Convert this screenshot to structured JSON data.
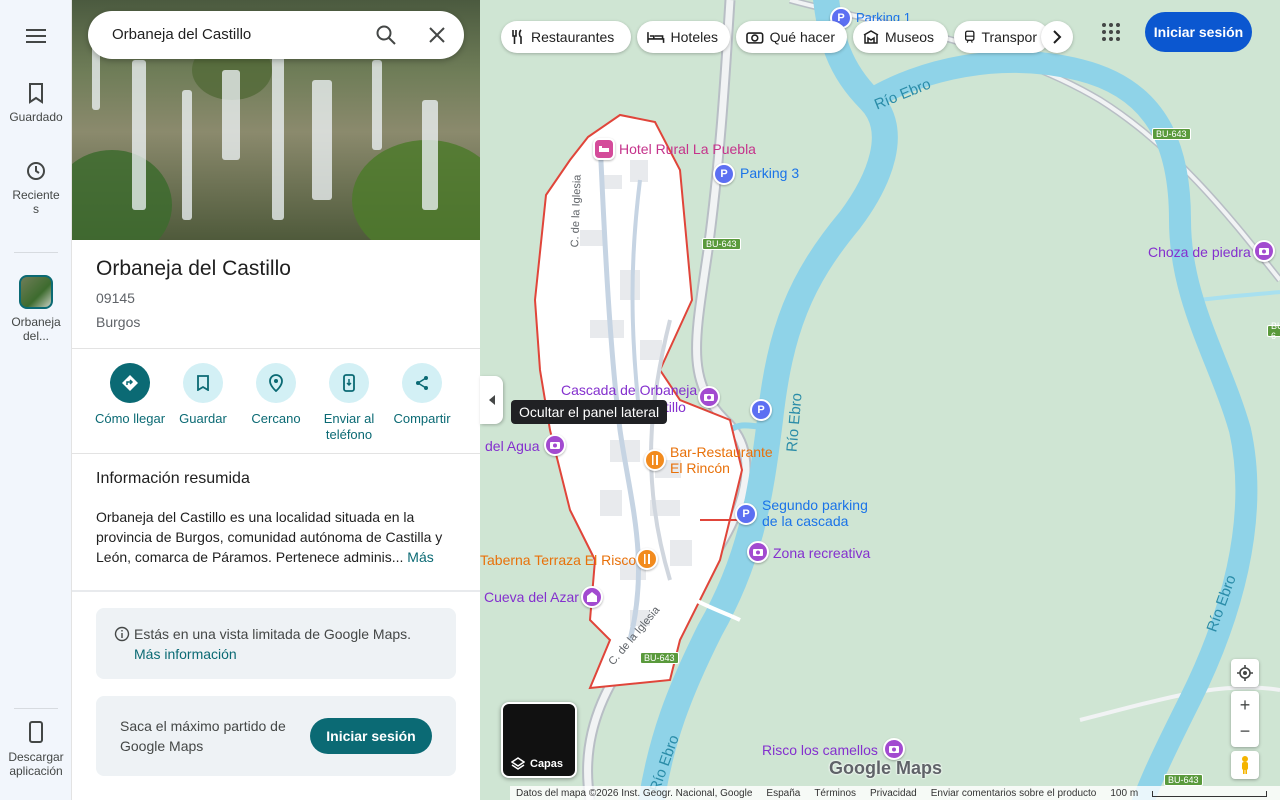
{
  "rail": {
    "saved_label": "Guardado",
    "recent_label_1": "Reciente",
    "recent_label_2": "s",
    "place_label_1": "Orbaneja",
    "place_label_2": "del...",
    "download_label_1": "Descargar",
    "download_label_2": "aplicación"
  },
  "search": {
    "query": "Orbaneja del Castillo"
  },
  "place": {
    "title": "Orbaneja del Castillo",
    "postal_code": "09145",
    "province": "Burgos"
  },
  "actions": {
    "directions": "Cómo llegar",
    "save": "Guardar",
    "nearby": "Cercano",
    "send_1": "Enviar al",
    "send_2": "teléfono",
    "share": "Compartir"
  },
  "summary": {
    "heading": "Información resumida",
    "text": "Orbaneja del Castillo es una localidad situada en la provincia de Burgos, comunidad autónoma de Castilla y León, comarca de Páramos. Pertenece adminis...",
    "more": "Más"
  },
  "limited": {
    "text": "Estás en una vista limitada de Google Maps.",
    "link": "Más información"
  },
  "promo": {
    "text_1": "Saca el máximo partido de",
    "text_2": "Google Maps",
    "button": "Iniciar sesión"
  },
  "chips": [
    "Restaurantes",
    "Hoteles",
    "Qué hacer",
    "Museos",
    "Transpor"
  ],
  "header": {
    "signin": "Iniciar sesión"
  },
  "tooltip": "Ocultar el panel lateral",
  "map_labels": {
    "hotel": "Hotel Rural La Puebla",
    "parking3": "Parking 3",
    "parking1": "Parking 1",
    "cascada_1": "Cascada de Orbaneja",
    "cascada_2": "Castillo",
    "bar_1": "Bar-Restaurante",
    "bar_2": "El Rincón",
    "segundo_1": "Segundo parking",
    "segundo_2": "de la cascada",
    "zona": "Zona recreativa",
    "taberna": "Taberna Terraza El Risco",
    "cueva": "Cueva del Azar",
    "agua": "del Agua",
    "choza": "Choza de piedra",
    "risco": "Risco los camellos",
    "river": "Río Ebro",
    "street": "C. de la Iglesia",
    "road": "BU-643",
    "road_cut": "BU-6",
    "parking_letter": "P"
  },
  "layers_label": "Capas",
  "logo": "Google Maps",
  "footer": {
    "data": "Datos del mapa ©2026 Inst. Geogr. Nacional, Google",
    "country": "España",
    "terms": "Términos",
    "privacy": "Privacidad",
    "feedback": "Enviar comentarios sobre el producto",
    "scale": "100 m"
  },
  "colors": {
    "accent": "#0b6a74",
    "brand": "#0b57d0",
    "boundary": "#e0453a",
    "river": "#8fd3e8"
  }
}
